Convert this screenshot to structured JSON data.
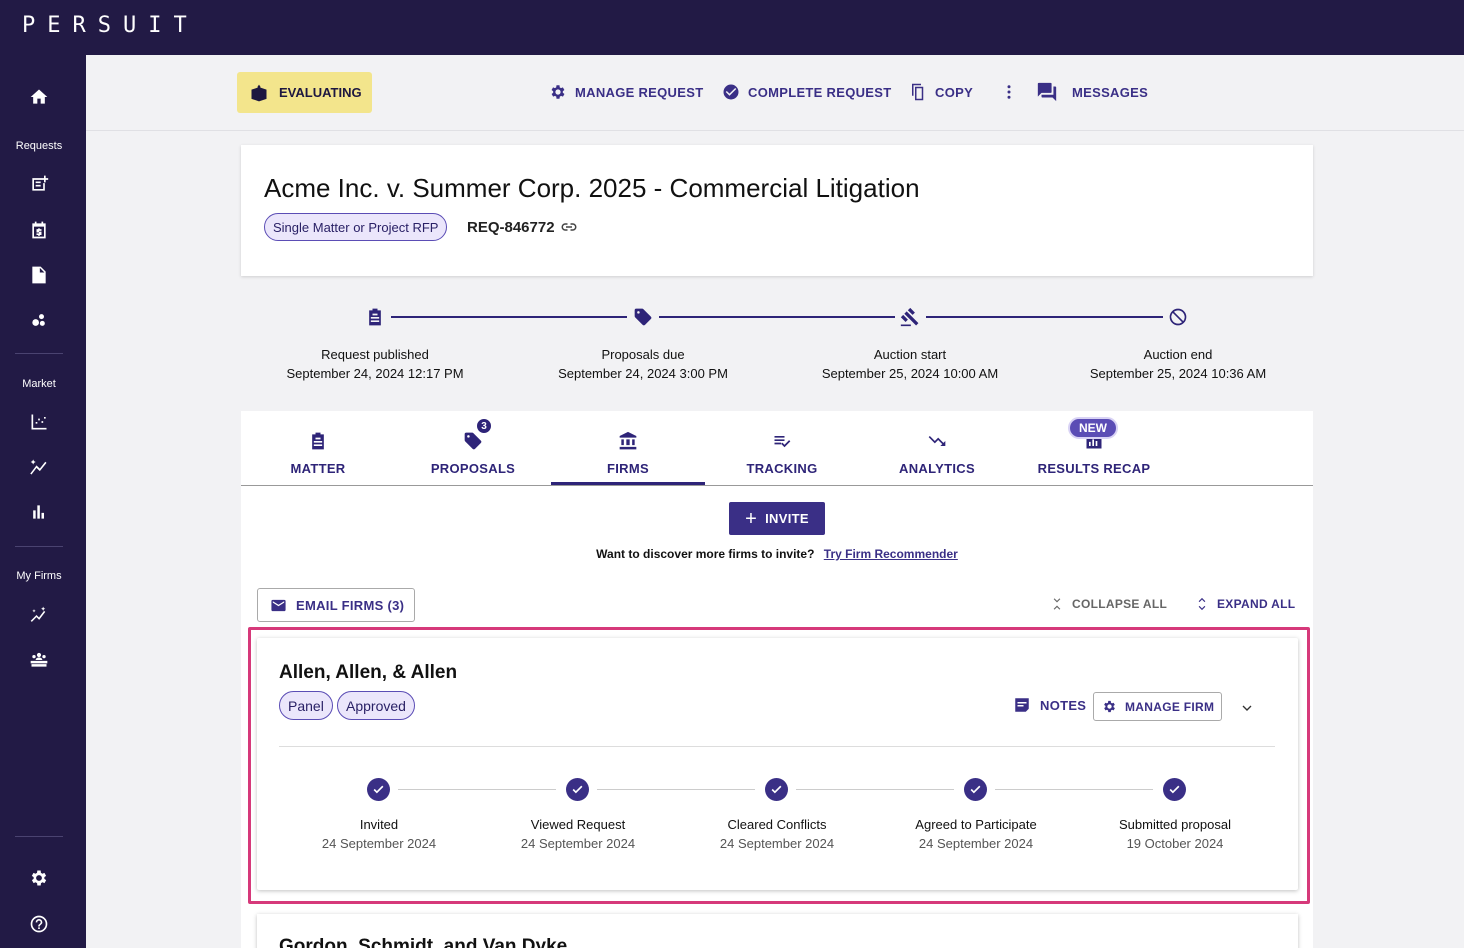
{
  "app": {
    "logo": "PERSUIT"
  },
  "sidebar": {
    "sections": {
      "requests": "Requests",
      "market": "Market",
      "my_firms": "My Firms"
    },
    "icons": [
      "home-icon",
      "new-request-icon",
      "calendar-budget-icon",
      "document-icon",
      "bubbles-icon",
      "chart-scatter-icon",
      "sparkle-chart-icon",
      "bar-chart-icon",
      "magic-icon",
      "team-icon",
      "settings-icon",
      "help-icon"
    ]
  },
  "actionbar": {
    "status": "EVALUATING",
    "manage_request": "MANAGE REQUEST",
    "complete_request": "COMPLETE REQUEST",
    "copy": "COPY",
    "messages": "MESSAGES"
  },
  "request": {
    "title": "Acme Inc. v. Summer Corp. 2025 - Commercial Litigation",
    "type": "Single Matter or Project RFP",
    "id": "REQ-846772"
  },
  "timeline": [
    {
      "label": "Request published",
      "date": "September 24, 2024 12:17 PM",
      "icon": "clipboard-icon"
    },
    {
      "label": "Proposals due",
      "date": "September 24, 2024 3:00 PM",
      "icon": "tag-icon"
    },
    {
      "label": "Auction start",
      "date": "September 25, 2024 10:00 AM",
      "icon": "gavel-icon"
    },
    {
      "label": "Auction end",
      "date": "September 25, 2024 10:36 AM",
      "icon": "block-icon"
    }
  ],
  "tabs": [
    {
      "label": "MATTER"
    },
    {
      "label": "PROPOSALS",
      "badge": "3"
    },
    {
      "label": "FIRMS",
      "active": true
    },
    {
      "label": "TRACKING"
    },
    {
      "label": "ANALYTICS"
    },
    {
      "label": "RESULTS RECAP",
      "badge": "NEW"
    }
  ],
  "firms_panel": {
    "invite": "INVITE",
    "discover_text": "Want to discover more firms to invite?",
    "discover_link": "Try Firm Recommender",
    "email_firms": "EMAIL FIRMS (3)",
    "collapse_all": "COLLAPSE ALL",
    "expand_all": "EXPAND ALL"
  },
  "firms": [
    {
      "name": "Allen, Allen, & Allen",
      "tags": [
        "Panel",
        "Approved"
      ],
      "notes": "NOTES",
      "manage_firm": "MANAGE FIRM",
      "steps": [
        {
          "title": "Invited",
          "date": "24 September 2024"
        },
        {
          "title": "Viewed Request",
          "date": "24 September 2024"
        },
        {
          "title": "Cleared Conflicts",
          "date": "24 September 2024"
        },
        {
          "title": "Agreed to Participate",
          "date": "24 September 2024"
        },
        {
          "title": "Submitted proposal",
          "date": "19 October 2024"
        }
      ]
    },
    {
      "name": "Gordon, Schmidt, and Van Dyke"
    }
  ],
  "colors": {
    "navy": "#221a45",
    "accent": "#3a2f86",
    "status_yellow": "#f3e58c",
    "highlight": "#d6397a"
  }
}
